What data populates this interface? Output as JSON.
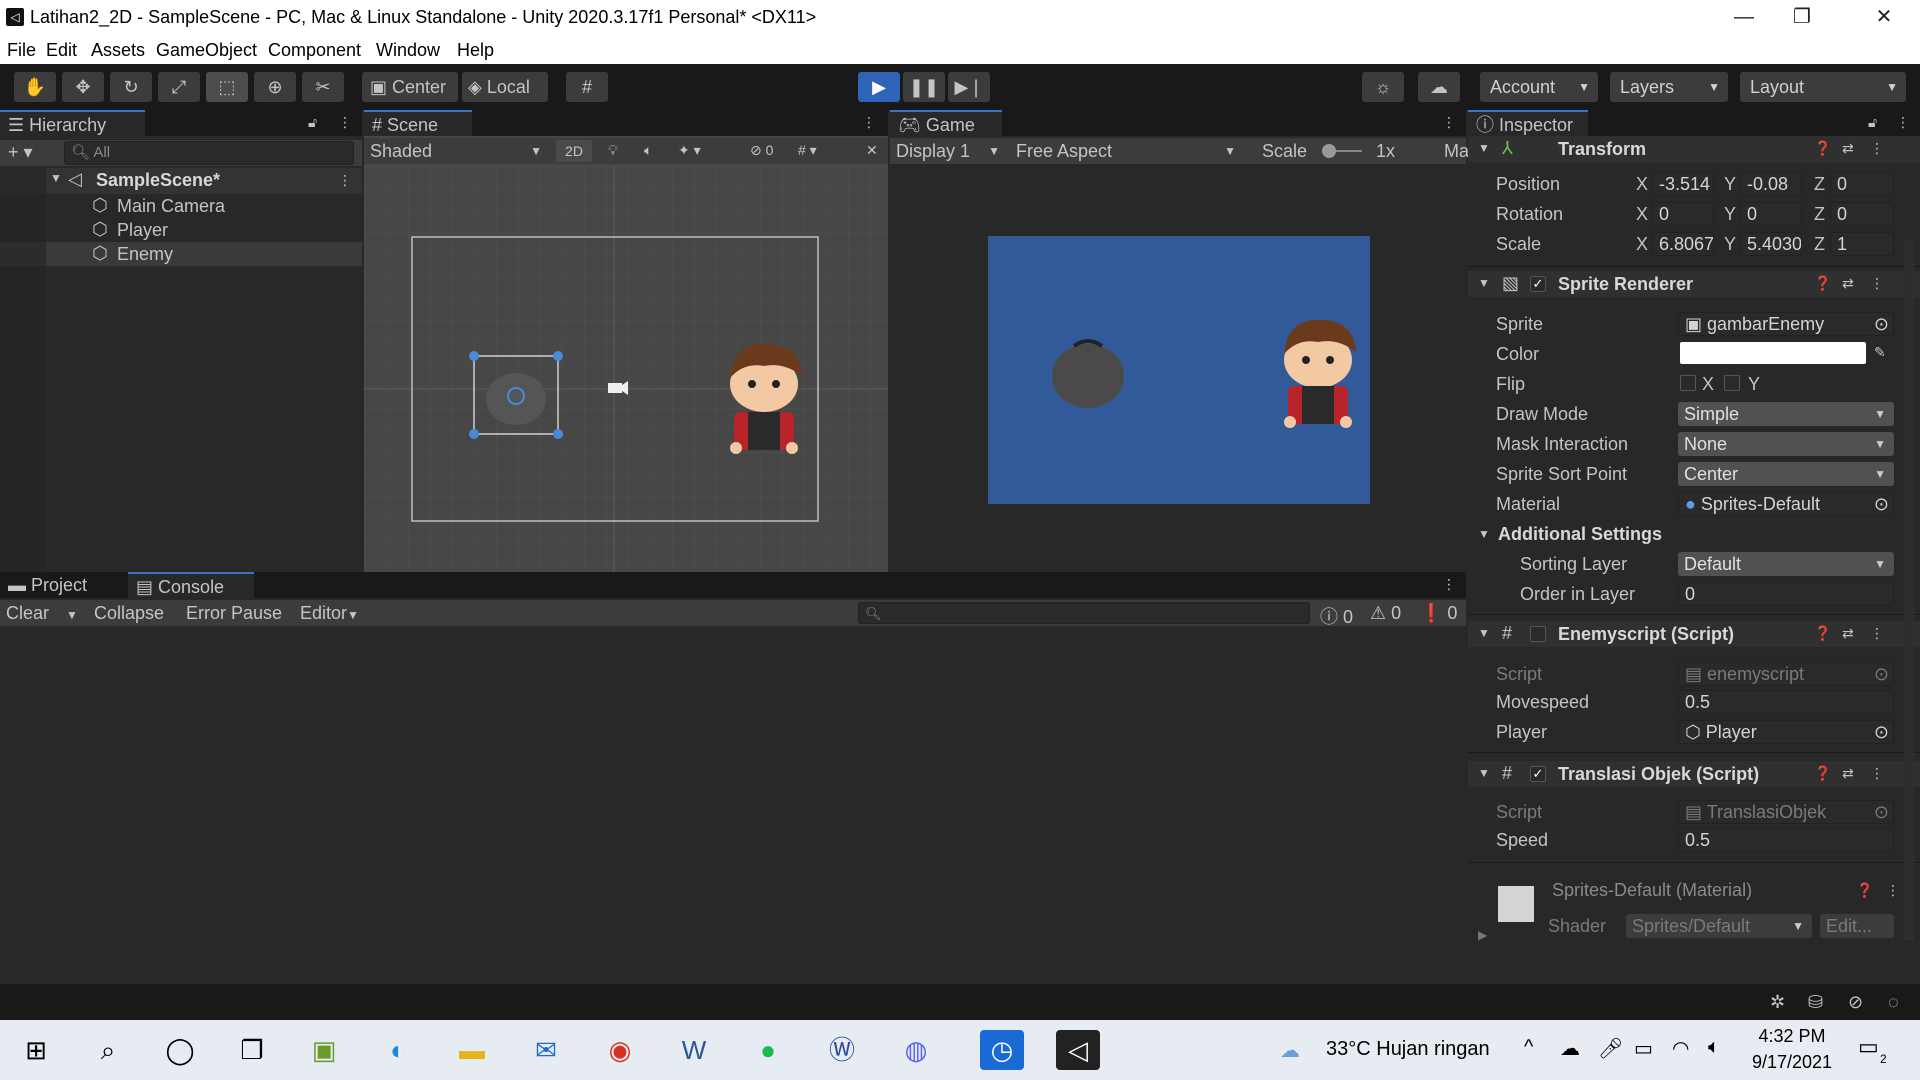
{
  "window": {
    "title": "Latihan2_2D - SampleScene - PC, Mac & Linux Standalone - Unity 2020.3.17f1 Personal* <DX11>",
    "minimize": "—",
    "maximize": "❐",
    "close": "✕"
  },
  "menu": [
    "File",
    "Edit",
    "Assets",
    "GameObject",
    "Component",
    "Window",
    "Help"
  ],
  "toolbar": {
    "pivot_label": "Center",
    "space_label": "Local",
    "account": "Account",
    "layers": "Layers",
    "layout": "Layout"
  },
  "hierarchy": {
    "tab": "Hierarchy",
    "search_placeholder": "All",
    "scene": "SampleScene*",
    "items": [
      "Main Camera",
      "Player",
      "Enemy"
    ],
    "selected": "Enemy"
  },
  "scene_view": {
    "tab": "Scene",
    "shading": "Shaded",
    "mode_2d": "2D",
    "hidden_count": "0"
  },
  "game_view": {
    "tab": "Game",
    "display": "Display 1",
    "aspect": "Free Aspect",
    "scale_label": "Scale",
    "scale_value": "1x",
    "maximize_label": "Ma",
    "background_color": "#325a99"
  },
  "console": {
    "tab_project": "Project",
    "tab_console": "Console",
    "clear": "Clear",
    "collapse": "Collapse",
    "error_pause": "Error Pause",
    "editor": "Editor",
    "info_count": "0",
    "warn_count": "0",
    "error_count": "0"
  },
  "inspector": {
    "tab": "Inspector",
    "transform": {
      "title": "Transform",
      "position": {
        "label": "Position",
        "x": "-3.514",
        "y": "-0.08",
        "z": "0"
      },
      "rotation": {
        "label": "Rotation",
        "x": "0",
        "y": "0",
        "z": "0"
      },
      "scale": {
        "label": "Scale",
        "x": "6.8067",
        "y": "5.4030",
        "z": "1"
      }
    },
    "sprite_renderer": {
      "title": "Sprite Renderer",
      "sprite_label": "Sprite",
      "sprite": "gambarEnemy",
      "color_label": "Color",
      "flip_label": "Flip",
      "flip_x": "X",
      "flip_y": "Y",
      "draw_mode_label": "Draw Mode",
      "draw_mode": "Simple",
      "mask_label": "Mask Interaction",
      "mask": "None",
      "sort_point_label": "Sprite Sort Point",
      "sort_point": "Center",
      "material_label": "Material",
      "material": "Sprites-Default",
      "additional": "Additional Settings",
      "sorting_layer_label": "Sorting Layer",
      "sorting_layer": "Default",
      "order_label": "Order in Layer",
      "order": "0"
    },
    "enemy_script": {
      "title": "Enemyscript (Script)",
      "script_label": "Script",
      "script": "enemyscript",
      "movespeed_label": "Movespeed",
      "movespeed": "0.5",
      "player_label": "Player",
      "player": "Player"
    },
    "translasi_script": {
      "title": "Translasi Objek (Script)",
      "script_label": "Script",
      "script": "TranslasiObjek",
      "speed_label": "Speed",
      "speed": "0.5"
    },
    "material": {
      "title": "Sprites-Default (Material)",
      "shader_label": "Shader",
      "shader": "Sprites/Default",
      "edit": "Edit..."
    }
  },
  "taskbar": {
    "weather": "33°C  Hujan ringan",
    "time": "4:32 PM",
    "date": "9/17/2021",
    "notif_count": "2"
  }
}
